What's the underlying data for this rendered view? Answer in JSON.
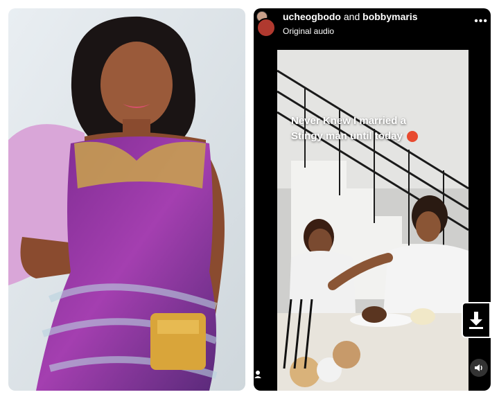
{
  "reel": {
    "user1": "ucheogbodo",
    "and_word": "and",
    "user2": "bobbymaris",
    "audio": "Original audio",
    "caption_line1": "Never Knew I married a",
    "caption_line2": "Stingy man until today",
    "more_icon": "more-dots-icon",
    "download_icon": "download-icon",
    "volume_icon": "volume-icon"
  }
}
